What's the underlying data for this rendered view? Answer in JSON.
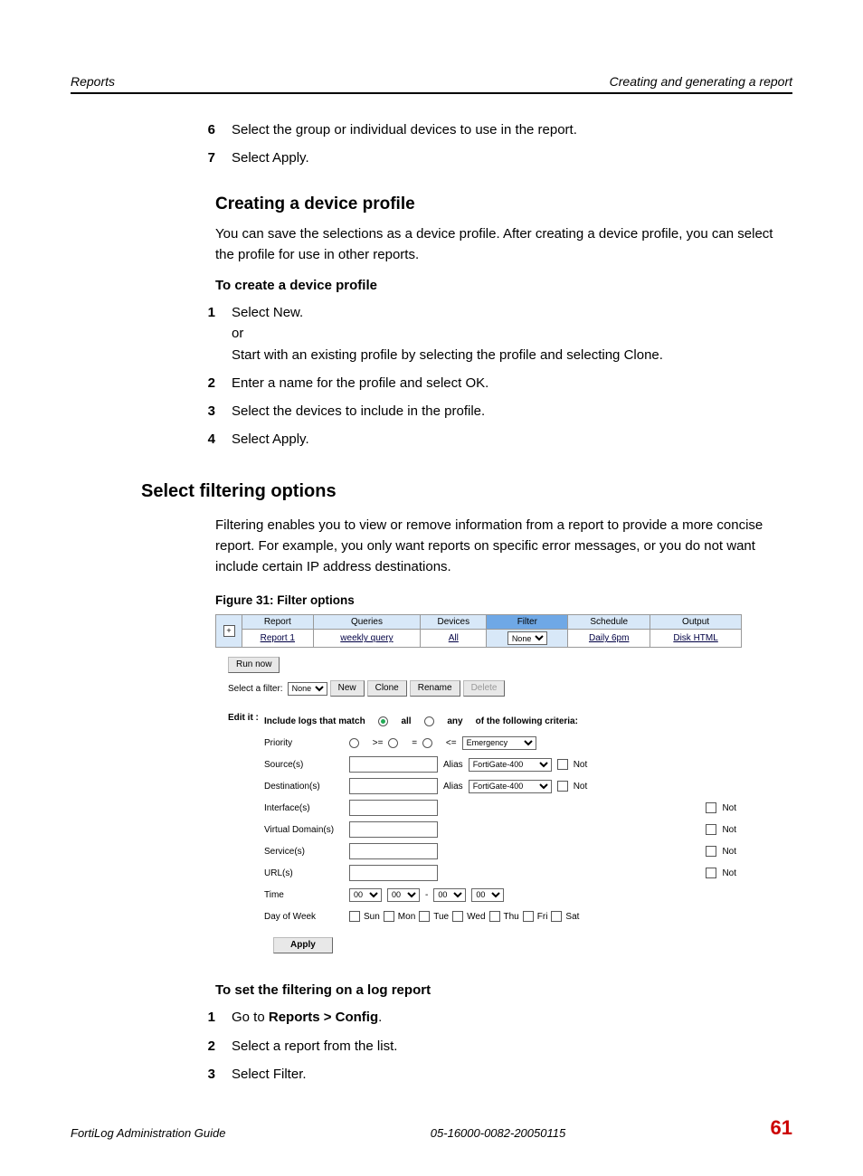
{
  "header": {
    "left": "Reports",
    "right": "Creating and generating a report"
  },
  "pre_steps": [
    {
      "n": "6",
      "text": "Select the group or individual devices to use in the report."
    },
    {
      "n": "7",
      "text": "Select Apply."
    }
  ],
  "h_create": "Creating a device profile",
  "p_create": "You can save the selections as a device profile. After creating a device profile, you can select the profile for use in other reports.",
  "sub_to_create": "To create a device profile",
  "create_steps": [
    {
      "n": "1",
      "lines": [
        "Select New.",
        "or",
        "Start with an existing profile by selecting the profile and selecting Clone."
      ]
    },
    {
      "n": "2",
      "lines": [
        "Enter a name for the profile and select OK."
      ]
    },
    {
      "n": "3",
      "lines": [
        "Select the devices to include in the profile."
      ]
    },
    {
      "n": "4",
      "lines": [
        "Select Apply."
      ]
    }
  ],
  "h_filter_opts": "Select filtering options",
  "p_filter": "Filtering enables you to view or remove information from a report to provide a more concise report. For example, you only want reports on specific error messages, or you do not want include certain IP address destinations.",
  "fig_caption": "Figure 31: Filter options",
  "figure": {
    "tabs": [
      "Report",
      "Queries",
      "Devices",
      "Filter",
      "Schedule",
      "Output"
    ],
    "active_tab": "Filter",
    "row_values": {
      "report": "Report 1",
      "queries": "weekly query",
      "devices": "All",
      "filter_select": "None",
      "schedule": "Daily 6pm",
      "output": "Disk HTML"
    },
    "run_now": "Run now",
    "select_filter_label": "Select a filter:",
    "select_filter_value": "None",
    "buttons": {
      "new": "New",
      "clone": "Clone",
      "rename": "Rename",
      "delete": "Delete"
    },
    "edit_label": "Edit it :",
    "include_prefix": "Include logs that match",
    "include_suffix": "of the following criteria:",
    "radio_all": "all",
    "radio_any": "any",
    "rows": {
      "priority": "Priority",
      "priority_ops": [
        ">=",
        "=",
        "<="
      ],
      "priority_value": "Emergency",
      "sources": "Source(s)",
      "destinations": "Destination(s)",
      "interfaces": "Interface(s)",
      "virtual_domains": "Virtual Domain(s)",
      "services": "Service(s)",
      "urls": "URL(s)",
      "alias_label": "Alias",
      "alias_value": "FortiGate-400",
      "not": "Not",
      "time": "Time",
      "time_val": "00",
      "time_dash": "-",
      "dow": "Day of Week",
      "days": [
        "Sun",
        "Mon",
        "Tue",
        "Wed",
        "Thu",
        "Fri",
        "Sat"
      ]
    },
    "apply": "Apply"
  },
  "sub_to_set": "To set the filtering on a log report",
  "set_steps": [
    {
      "n": "1",
      "pre": "Go to ",
      "bold": "Reports > Config",
      "post": "."
    },
    {
      "n": "2",
      "pre": "Select a report from the list.",
      "bold": "",
      "post": ""
    },
    {
      "n": "3",
      "pre": "Select Filter.",
      "bold": "",
      "post": ""
    }
  ],
  "footer": {
    "left": "FortiLog Administration Guide",
    "mid": "05-16000-0082-20050115",
    "right": "61"
  }
}
